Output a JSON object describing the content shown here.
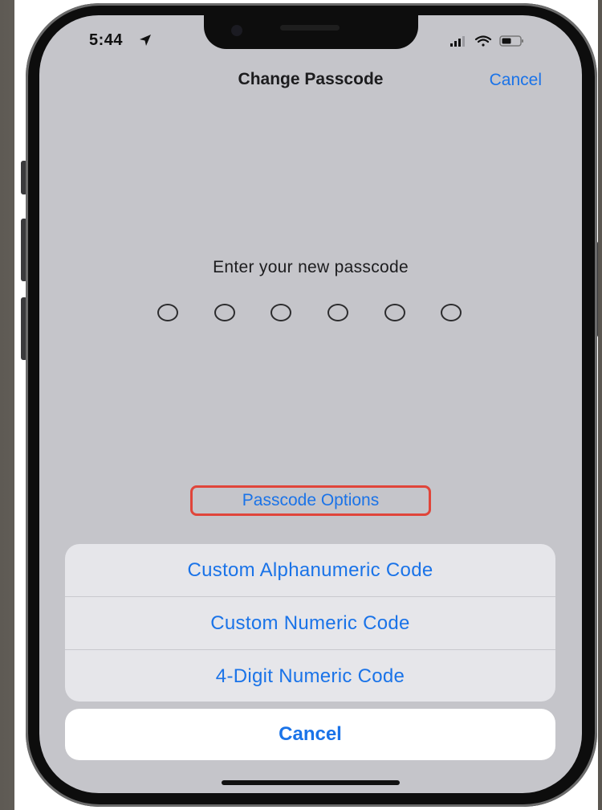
{
  "status_bar": {
    "time": "5:44",
    "icons": [
      "location-arrow-icon",
      "cellular-signal-icon",
      "wifi-icon",
      "battery-icon"
    ]
  },
  "nav": {
    "title": "Change Passcode",
    "cancel_label": "Cancel"
  },
  "passcode": {
    "prompt": "Enter your new passcode",
    "digit_count": 6
  },
  "options_button": {
    "label": "Passcode Options"
  },
  "action_sheet": {
    "items": [
      {
        "label": "Custom Alphanumeric Code"
      },
      {
        "label": "Custom Numeric Code"
      },
      {
        "label": "4-Digit Numeric Code"
      }
    ],
    "cancel_label": "Cancel"
  },
  "colors": {
    "accent": "#1a73e8",
    "highlight": "#e0453a",
    "screen_bg": "#c5c5ca"
  }
}
